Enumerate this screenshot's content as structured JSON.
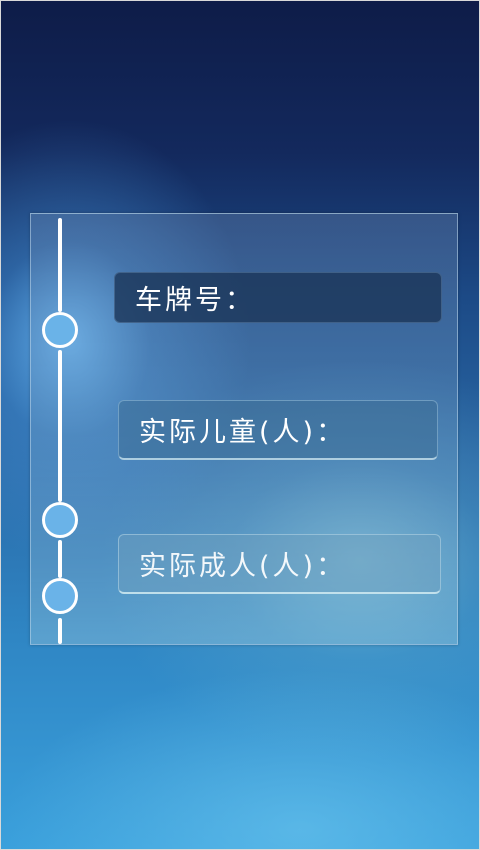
{
  "form": {
    "plate_label": "车牌号：",
    "children_label": "实际儿童(人)：",
    "adults_label": "实际成人(人)："
  },
  "colors": {
    "background_top": "#0e1c48",
    "background_bottom": "#3aa0dc",
    "timeline_dot_fill": "#6ab3e8",
    "timeline_line": "#ffffff"
  }
}
